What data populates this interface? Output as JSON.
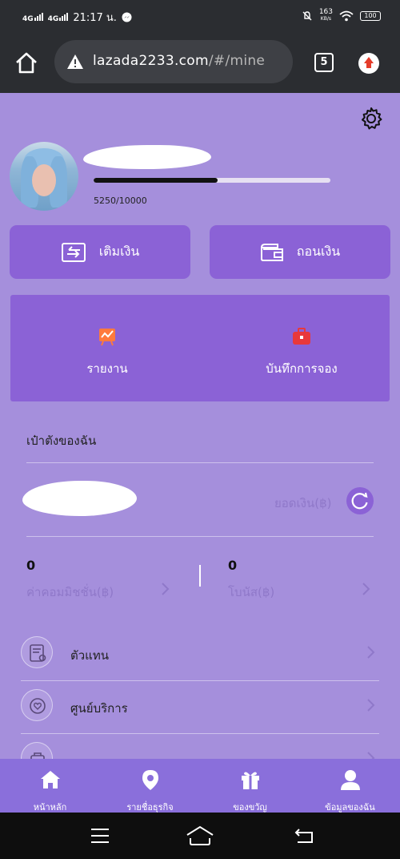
{
  "status_bar": {
    "network1": "4G",
    "network2": "4G",
    "time": "21:17 น.",
    "speed_value": "163",
    "speed_unit": "KB/s",
    "battery": "100"
  },
  "browser": {
    "url_host": "lazada2233.com",
    "url_path": "/#/mine",
    "tab_count": "5"
  },
  "profile": {
    "progress_text": "5250/10000",
    "progress_fraction": 0.525
  },
  "actions": {
    "deposit_label": "เติมเงิน",
    "withdraw_label": "ถอนเงิน"
  },
  "quick_links": {
    "report_label": "รายงาน",
    "booking_label": "บันทึกการจอง"
  },
  "wallet": {
    "title": "เป๋าตังของฉัน",
    "balance_label": "ยอดเงิน(฿)",
    "commission_value": "0",
    "commission_label": "ค่าคอมมิชชั่น(฿)",
    "bonus_value": "0",
    "bonus_label": "โบนัส(฿)"
  },
  "menu": {
    "items": [
      {
        "label": "ตัวแทน",
        "icon": "agent-certificate-icon"
      },
      {
        "label": "ศูนย์บริการ",
        "icon": "service-heart-icon"
      },
      {
        "label": "",
        "icon": "bag-icon"
      }
    ]
  },
  "bottom_nav": {
    "tabs": [
      {
        "label": "หน้าหลัก",
        "icon": "home-icon"
      },
      {
        "label": "รายชื่อธุรกิจ",
        "icon": "location-pin-icon"
      },
      {
        "label": "ของขวัญ",
        "icon": "gift-icon"
      },
      {
        "label": "ข้อมูลของฉัน",
        "icon": "user-icon"
      }
    ],
    "active_index": 3
  },
  "colors": {
    "page_bg": "#a58fdc",
    "card": "#8b62d6",
    "nav": "#8a6fdb",
    "muted_text": "#8f78c9"
  }
}
